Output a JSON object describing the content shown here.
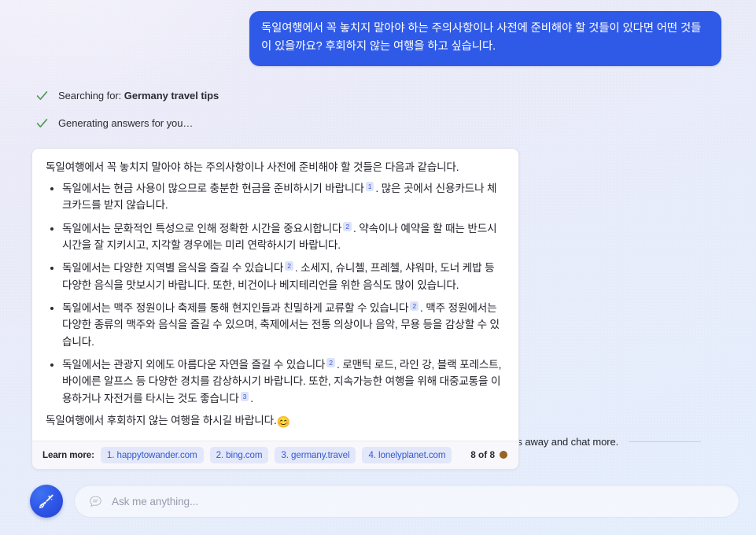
{
  "conversation": {
    "user_message": "독일여행에서 꼭 놓치지 말아야 하는 주의사항이나 사전에 준비해야 할 것들이 있다면 어떤 것들이 있을까요? 후회하지 않는 여행을 하고 싶습니다.",
    "status_steps": [
      {
        "icon": "check-icon",
        "prefix": "Searching for: ",
        "query": "Germany travel tips",
        "full": "Searching for: Germany travel tips"
      },
      {
        "icon": "check-icon",
        "prefix": "",
        "query": "",
        "full": "Generating answers for you…"
      }
    ],
    "answer": {
      "intro": "독일여행에서 꼭 놓치지 말아야 하는 주의사항이나 사전에 준비해야 할 것들은 다음과 같습니다.",
      "bullets": [
        {
          "text_before": "독일에서는 현금 사용이 많으므로 충분한 현금을 준비하시기 바랍니다",
          "citation": "1",
          "text_after": ". 많은 곳에서 신용카드나 체크카드를 받지 않습니다."
        },
        {
          "text_before": "독일에서는 문화적인 특성으로 인해 정확한 시간을 중요시합니다",
          "citation": "2",
          "text_after": ". 약속이나 예약을 할 때는 반드시 시간을 잘 지키시고, 지각할 경우에는 미리 연락하시기 바랍니다."
        },
        {
          "text_before": "독일에서는 다양한 지역별 음식을 즐길 수 있습니다",
          "citation": "2",
          "text_after": ". 소세지, 슈니첼, 프레첼, 샤워마, 도너 케밥 등 다양한 음식을 맛보시기 바랍니다. 또한, 비건이나 베지테리언을 위한 음식도 많이 있습니다."
        },
        {
          "text_before": "독일에서는 맥주 정원이나 축제를 통해 현지인들과 친밀하게 교류할 수 있습니다",
          "citation": "2",
          "text_after": ". 맥주 정원에서는 다양한 종류의 맥주와 음식을 즐길 수 있으며, 축제에서는 전통 의상이나 음악, 무용 등을 감상할 수 있습니다."
        },
        {
          "text_before": "독일에서는 관광지 외에도 아름다운 자연을 즐길 수 있습니다",
          "citation": "2",
          "text_after": ". 로맨틱 로드, 라인 강, 블랙 포레스트, 바이에른 알프스 등 다양한 경치를 감상하시기 바랍니다. 또한, 지속가능한 여행을 위해 대중교통을 이용하거나 자전거를 타시는 것도 좋습니다",
          "citation2": "3",
          "text_end": "."
        }
      ],
      "outro": "독일여행에서 후회하지 않는 여행을 하시길 바랍니다.",
      "outro_emoji": "😊"
    },
    "footer": {
      "learn_more_label": "Learn more:",
      "sources": [
        "1. happytowander.com",
        "2. bing.com",
        "3. germany.travel",
        "4. lonelyplanet.com"
      ],
      "turn_counter": "8 of 8",
      "turn_dot_color": "#9a6024"
    }
  },
  "limit_notice": {
    "icon": "warning-triangle-icon",
    "text": "Sorry, this conversation has reached its limit. Use the \"broom\" button to sweep this away and chat more."
  },
  "composer": {
    "broom_button_name": "broom-button",
    "input_icon": "chat-bubble-icon",
    "input_value": "",
    "input_placeholder": "Ask me anything..."
  },
  "colors": {
    "user_bubble": "#2f5ae8",
    "accent_blue": "#3558cf",
    "citation_bg": "#dde3f8",
    "check_green": "#4f9a54",
    "turn_dot": "#9a6024"
  }
}
